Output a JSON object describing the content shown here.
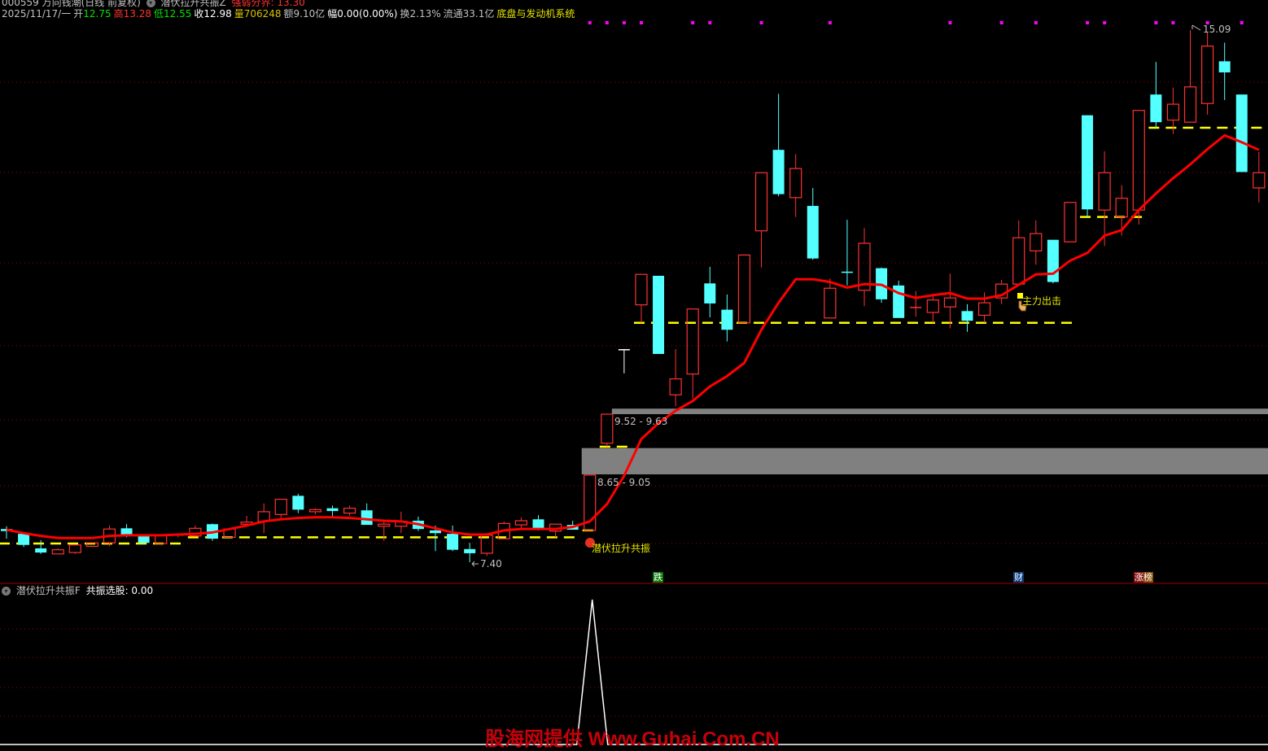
{
  "header": {
    "stock": "000559 万向钱潮(日线 前复权)",
    "indicator_name": "潜伏拉升共振Z",
    "strength_label": "强弱分界: 13.30",
    "date": "2025/11/17/一",
    "open_label": "开",
    "open": "12.75",
    "high_label": "高",
    "high": "13.28",
    "low_label": "低",
    "low": "12.55",
    "close_label": "收",
    "close": "12.98",
    "volume_label": "量",
    "volume": "706248",
    "amount": "额9.10亿",
    "change": "幅0.00(0.00%)",
    "turnover": "换2.13%",
    "float": "流通33.1亿",
    "system": "底盘与发动机系统"
  },
  "sub_header": {
    "indicator_name": "潜伏拉升共振F",
    "value_label": "共振选股: 0.00"
  },
  "annotations": {
    "high_price": "15.09",
    "low_price": "7.40",
    "band_upper": "9.52 - 9.63",
    "band_lower": "8.65 - 9.05",
    "signal": "潜伏拉升共振",
    "main_force": "主力出击",
    "event_fall": "跌",
    "event_finance": "财",
    "event_rise": "涨榜"
  },
  "watermark": "股海网提供 Www.Guhai.Com.CN",
  "colors": {
    "up": "#ff3232",
    "down": "#54ffff",
    "ma": "#ff0000",
    "support": "#ffff00",
    "grid": "#a00000",
    "band": "#808080"
  },
  "chart_data": {
    "type": "candlestick",
    "ylim": [
      7.4,
      15.09
    ],
    "candles": [
      [
        7.88,
        7.92,
        7.74,
        7.85
      ],
      [
        7.81,
        7.81,
        7.62,
        7.65
      ],
      [
        7.6,
        7.72,
        7.52,
        7.54
      ],
      [
        7.52,
        7.6,
        7.52,
        7.58
      ],
      [
        7.54,
        7.65,
        7.52,
        7.65
      ],
      [
        7.63,
        7.68,
        7.63,
        7.68
      ],
      [
        7.68,
        7.93,
        7.63,
        7.88
      ],
      [
        7.89,
        7.95,
        7.76,
        7.8
      ],
      [
        7.78,
        7.79,
        7.66,
        7.68
      ],
      [
        7.67,
        7.79,
        7.67,
        7.79
      ],
      [
        7.8,
        7.81,
        7.76,
        7.8
      ],
      [
        7.78,
        7.93,
        7.78,
        7.89
      ],
      [
        7.95,
        7.96,
        7.71,
        7.74
      ],
      [
        7.76,
        7.88,
        7.76,
        7.88
      ],
      [
        7.95,
        8.07,
        7.92,
        7.98
      ],
      [
        7.99,
        8.25,
        7.82,
        8.13
      ],
      [
        8.09,
        8.31,
        8.04,
        8.31
      ],
      [
        8.36,
        8.39,
        8.11,
        8.16
      ],
      [
        8.13,
        8.18,
        8.09,
        8.16
      ],
      [
        8.18,
        8.22,
        8.06,
        8.14
      ],
      [
        8.11,
        8.22,
        8.07,
        8.18
      ],
      [
        8.15,
        8.25,
        7.94,
        7.94
      ],
      [
        7.92,
        7.99,
        7.71,
        7.95
      ],
      [
        7.92,
        8.13,
        7.82,
        7.99
      ],
      [
        8.0,
        8.06,
        7.85,
        7.88
      ],
      [
        7.86,
        7.93,
        7.56,
        7.82
      ],
      [
        7.81,
        7.93,
        7.56,
        7.58
      ],
      [
        7.59,
        7.68,
        7.4,
        7.53
      ],
      [
        7.53,
        7.79,
        7.49,
        7.79
      ],
      [
        7.74,
        7.99,
        7.74,
        7.96
      ],
      [
        7.94,
        8.05,
        7.88,
        8.0
      ],
      [
        8.02,
        8.08,
        7.86,
        7.88
      ],
      [
        7.85,
        7.95,
        7.76,
        7.95
      ],
      [
        7.94,
        8.0,
        7.87,
        7.87
      ],
      [
        7.86,
        8.66,
        7.86,
        8.66
      ],
      [
        9.12,
        9.54,
        9.07,
        9.54
      ],
      [
        10.48,
        10.48,
        10.13,
        10.48
      ],
      [
        11.12,
        11.56,
        10.86,
        11.56
      ],
      [
        11.54,
        11.54,
        10.41,
        10.41
      ],
      [
        9.82,
        10.48,
        9.65,
        10.05
      ],
      [
        10.12,
        11.06,
        9.76,
        11.06
      ],
      [
        11.43,
        11.67,
        10.94,
        11.14
      ],
      [
        11.05,
        11.27,
        10.59,
        10.76
      ],
      [
        10.86,
        11.84,
        10.86,
        11.84
      ],
      [
        12.19,
        13.03,
        11.66,
        13.03
      ],
      [
        13.36,
        14.17,
        12.69,
        12.72
      ],
      [
        12.67,
        13.3,
        12.39,
        13.09
      ],
      [
        12.55,
        12.81,
        11.77,
        11.79
      ],
      [
        10.93,
        11.5,
        10.93,
        11.36
      ],
      [
        11.6,
        12.35,
        11.4,
        11.6
      ],
      [
        11.33,
        12.23,
        11.1,
        12.01
      ],
      [
        11.65,
        11.66,
        11.15,
        11.2
      ],
      [
        11.4,
        11.47,
        10.93,
        10.93
      ],
      [
        11.09,
        11.32,
        10.95,
        11.09
      ],
      [
        11.01,
        11.28,
        10.86,
        11.19
      ],
      [
        11.09,
        11.57,
        10.78,
        11.22
      ],
      [
        11.03,
        11.13,
        10.73,
        10.89
      ],
      [
        10.97,
        11.3,
        10.86,
        11.15
      ],
      [
        11.22,
        11.48,
        11.13,
        11.42
      ],
      [
        11.42,
        12.34,
        11.42,
        12.09
      ],
      [
        11.9,
        12.34,
        11.7,
        12.15
      ],
      [
        12.06,
        12.06,
        11.43,
        11.45
      ],
      [
        12.03,
        12.6,
        12.03,
        12.6
      ],
      [
        13.86,
        13.86,
        12.39,
        12.5
      ],
      [
        12.49,
        13.34,
        11.97,
        13.03
      ],
      [
        12.39,
        12.85,
        12.12,
        12.66
      ],
      [
        12.49,
        13.93,
        12.28,
        13.93
      ],
      [
        14.16,
        14.63,
        13.68,
        13.76
      ],
      [
        13.79,
        14.26,
        13.59,
        14.02
      ],
      [
        13.76,
        15.09,
        13.76,
        14.27
      ],
      [
        14.03,
        15.07,
        13.87,
        14.86
      ],
      [
        14.64,
        14.91,
        14.08,
        14.48
      ],
      [
        14.16,
        14.16,
        13.04,
        13.04
      ],
      [
        12.81,
        13.33,
        12.6,
        13.03
      ]
    ],
    "ma": [
      7.87,
      7.82,
      7.78,
      7.75,
      7.75,
      7.75,
      7.78,
      7.79,
      7.79,
      7.79,
      7.8,
      7.81,
      7.83,
      7.88,
      7.93,
      7.99,
      8.02,
      8.04,
      8.05,
      8.05,
      8.04,
      8.02,
      8.0,
      7.99,
      7.95,
      7.89,
      7.83,
      7.8,
      7.8,
      7.86,
      7.88,
      7.88,
      7.88,
      7.91,
      7.99,
      8.24,
      8.65,
      9.18,
      9.41,
      9.59,
      9.73,
      9.94,
      10.09,
      10.28,
      10.76,
      11.15,
      11.49,
      11.49,
      11.45,
      11.37,
      11.42,
      11.41,
      11.29,
      11.22,
      11.26,
      11.29,
      11.21,
      11.21,
      11.26,
      11.41,
      11.56,
      11.57,
      11.76,
      11.87,
      12.12,
      12.2,
      12.49,
      12.73,
      12.95,
      13.15,
      13.37,
      13.57,
      13.47,
      13.36
    ],
    "support_lines": [
      {
        "price": 7.67,
        "from": 0,
        "to": 10
      },
      {
        "price": 7.76,
        "from": 11,
        "to": 33
      },
      {
        "price": 7.86,
        "from": 34,
        "to": 34
      },
      {
        "price": 9.07,
        "from": 35,
        "to": 36
      },
      {
        "price": 10.86,
        "from": 37,
        "to": 62
      },
      {
        "price": 12.39,
        "from": 63,
        "to": 66
      },
      {
        "price": 13.68,
        "from": 67,
        "to": 73
      }
    ],
    "bands": [
      {
        "low": 9.54,
        "high": 9.62,
        "from": 35
      },
      {
        "low": 8.67,
        "high": 9.05,
        "from": 34
      }
    ],
    "signal_dots": [
      34,
      35,
      36,
      37,
      40,
      41,
      44,
      48,
      55,
      58,
      60,
      63,
      64,
      67,
      68,
      70,
      72
    ],
    "sub_series": {
      "baseline": 0,
      "peak_index": 34,
      "peak_value": 1
    }
  }
}
